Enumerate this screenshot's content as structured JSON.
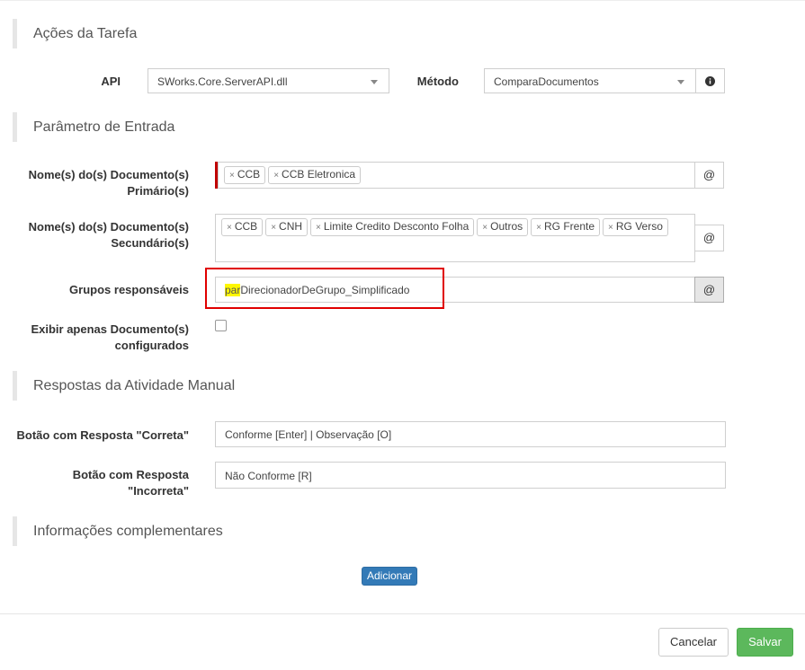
{
  "sections": {
    "acoes": "Ações da Tarefa",
    "parametro": "Parâmetro de Entrada",
    "respostas": "Respostas da Atividade Manual",
    "informacoes": "Informações complementares"
  },
  "api": {
    "label": "API",
    "value": "SWorks.Core.ServerAPI.dll"
  },
  "metodo": {
    "label": "Método",
    "value": "ComparaDocumentos",
    "info_icon": "info-circle-icon"
  },
  "primarios": {
    "label": "Nome(s) do(s) Documento(s) Primário(s)",
    "tags": [
      "CCB",
      "CCB Eletronica"
    ],
    "addon": "@"
  },
  "secundarios": {
    "label": "Nome(s) do(s) Documento(s) Secundário(s)",
    "tags": [
      "CCB",
      "CNH",
      "Limite Credito Desconto Folha",
      "Outros",
      "RG Frente",
      "RG Verso"
    ],
    "addon": "@"
  },
  "grupos": {
    "label": "Grupos responsáveis",
    "prefix": "par",
    "value": "DirecionadorDeGrupo_Simplificado",
    "addon": "@"
  },
  "exibir": {
    "label": "Exibir apenas Documento(s) configurados",
    "checked": false
  },
  "correta": {
    "label": "Botão com Resposta \"Correta\"",
    "value": "Conforme [Enter] | Observação [O]"
  },
  "incorreta": {
    "label": "Botão com Resposta \"Incorreta\"",
    "value": "Não Conforme [R]"
  },
  "buttons": {
    "adicionar": "Adicionar",
    "cancelar": "Cancelar",
    "salvar": "Salvar"
  },
  "tag_remove_symbol": "×",
  "colors": {
    "primary": "#337ab7",
    "success": "#5cb85c",
    "highlight_box": "#e00000",
    "required_bar": "#c00000"
  }
}
